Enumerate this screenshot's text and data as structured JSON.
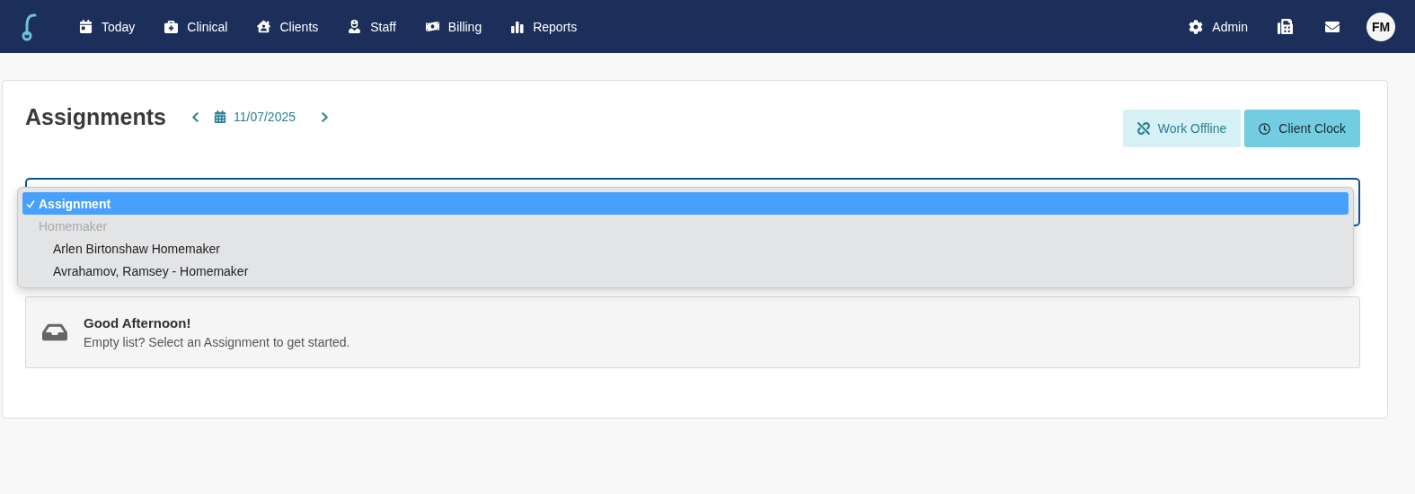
{
  "nav": {
    "items": [
      {
        "label": "Today"
      },
      {
        "label": "Clinical"
      },
      {
        "label": "Clients"
      },
      {
        "label": "Staff"
      },
      {
        "label": "Billing"
      },
      {
        "label": "Reports"
      }
    ],
    "admin": {
      "label": "Admin"
    },
    "avatar": {
      "initials": "FM"
    }
  },
  "page": {
    "title": "Assignments",
    "date": "11/07/2025",
    "buttons": [
      {
        "label": "Work Offline",
        "kind": "offline"
      },
      {
        "label": "Client Clock",
        "kind": "clock"
      }
    ]
  },
  "dropdown": {
    "options": [
      {
        "kind": "option",
        "label": "Assignment",
        "selected": true
      },
      {
        "kind": "group",
        "label": "Homemaker"
      },
      {
        "kind": "option",
        "label": "Arlen Birtonshaw Homemaker",
        "selected": false
      },
      {
        "kind": "option",
        "label": "Avrahamov, Ramsey - Homemaker",
        "selected": false
      }
    ]
  },
  "greeting": {
    "title": "Good Afternoon!",
    "message": "Empty list? Select an Assignment to get started."
  }
}
